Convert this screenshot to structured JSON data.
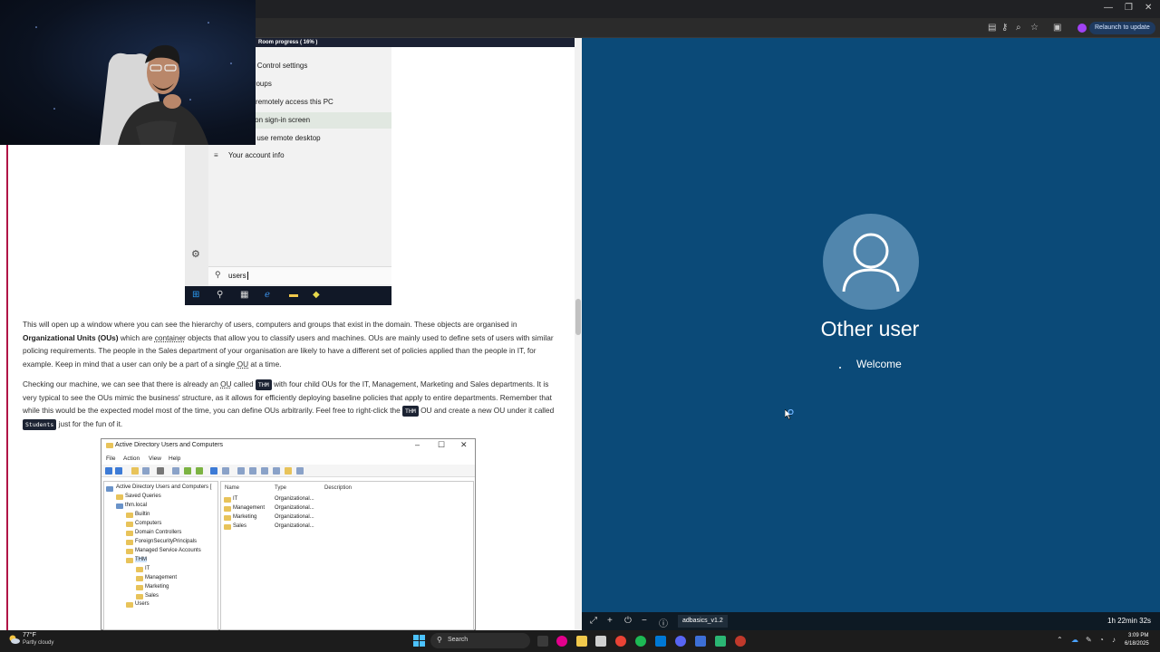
{
  "browser": {
    "relaunch_label": "Relaunch to update",
    "window_controls": [
      "—",
      "❐",
      "✕"
    ],
    "toolbar_icons": [
      "save-icon",
      "key-icon",
      "zoom-icon",
      "star-icon",
      "sidebar-icon"
    ]
  },
  "room": {
    "progress_label": "Room progress ( 16% )",
    "progress_percent": 16
  },
  "start_menu": {
    "items": [
      "User Account Control settings",
      "l users and groups",
      "sers that can remotely access this PC",
      "count details on sign-in screen",
      "sers who can use remote desktop",
      "Your account info"
    ],
    "highlighted_index": 3,
    "account_icon": "≡",
    "search_value": "users"
  },
  "doc": {
    "p1": {
      "t1": "This will open up a window where you can see the hierarchy of users, computers and groups that exist in the domain. These objects are organised in ",
      "b1": "Organizational Units (OUs)",
      "t2": " which are ",
      "u1": "container",
      "t3": " objects that allow you to classify users and machines. OUs are mainly used to define sets of users with similar policing requirements. The people in the Sales department of your organisation are likely to have a different set of policies applied than the people in IT, for example. Keep in mind that a user can only be a part of a single ",
      "u2": "OU",
      "t4": " at a time."
    },
    "p2": {
      "t1": "Checking our machine, we can see that there is already an ",
      "u1": "OU",
      "t2": " called ",
      "code1": "THM",
      "t3": " with four child OUs for the IT, Management, Marketing and Sales departments. It is very typical to see the OUs mimic the business' structure, as it allows for efficiently deploying baseline policies that apply to entire departments. Remember that while this would be the expected model most of the time, you can define OUs arbitrarily. Feel free to right-click the ",
      "code2": "THM",
      "t4": " OU and create a new OU under it called ",
      "code3": "Students",
      "t5": " just for the fun of it."
    }
  },
  "ad_window": {
    "title": "Active Directory Users and Computers",
    "menu": [
      "File",
      "Action",
      "View",
      "Help"
    ],
    "tree": [
      {
        "label": "Active Directory Users and Computers [",
        "level": 0
      },
      {
        "label": "Saved Queries",
        "level": 1
      },
      {
        "label": "thm.local",
        "level": 1
      },
      {
        "label": "Builtin",
        "level": 2
      },
      {
        "label": "Computers",
        "level": 2
      },
      {
        "label": "Domain Controllers",
        "level": 2
      },
      {
        "label": "ForeignSecurityPrincipals",
        "level": 2
      },
      {
        "label": "Managed Service Accounts",
        "level": 2
      },
      {
        "label": "THM",
        "level": 2
      },
      {
        "label": "IT",
        "level": 3
      },
      {
        "label": "Management",
        "level": 3
      },
      {
        "label": "Marketing",
        "level": 3
      },
      {
        "label": "Sales",
        "level": 3
      },
      {
        "label": "Users",
        "level": 2
      }
    ],
    "columns": [
      "Name",
      "Type",
      "Description"
    ],
    "rows": [
      {
        "name": "IT",
        "type": "Organizational..."
      },
      {
        "name": "Management",
        "type": "Organizational..."
      },
      {
        "name": "Marketing",
        "type": "Organizational..."
      },
      {
        "name": "Sales",
        "type": "Organizational..."
      }
    ]
  },
  "vm": {
    "user_label": "Other user",
    "welcome": "Welcome",
    "machine_name": "adbasics_v1.2",
    "timer": "1h 22min 32s",
    "controls": [
      "expand-icon",
      "plus-icon",
      "power-icon",
      "minus-icon",
      "info-icon"
    ]
  },
  "taskbar": {
    "weather_temp": "77°F",
    "weather_desc": "Partly cloudy",
    "search_placeholder": "Search",
    "time": "3:09 PM",
    "date": "6/18/2025"
  }
}
